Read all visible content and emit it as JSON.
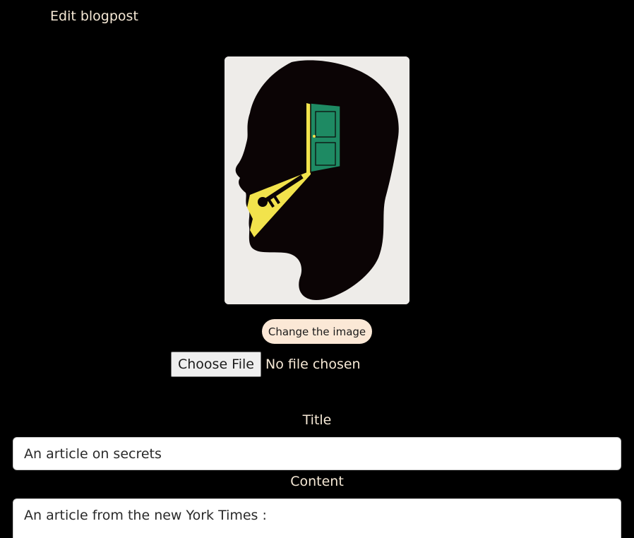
{
  "page": {
    "title": "Edit blogpost"
  },
  "image": {
    "icon": "head-silhouette-door-key-illustration",
    "colors": {
      "background": "#eeece9",
      "silhouette": "#0b0405",
      "door": "#1e8a63",
      "light": "#f2e34c"
    }
  },
  "image_controls": {
    "change_label": "Change the image",
    "choose_file_label": "Choose File",
    "no_file_text": "No file chosen"
  },
  "form": {
    "title_label": "Title",
    "title_value": "An article on secrets",
    "content_label": "Content",
    "content_value": "An article from the new York Times :"
  },
  "colors": {
    "background": "#000000",
    "text": "#f6e9d6",
    "button_bg": "#fbe8d6"
  }
}
